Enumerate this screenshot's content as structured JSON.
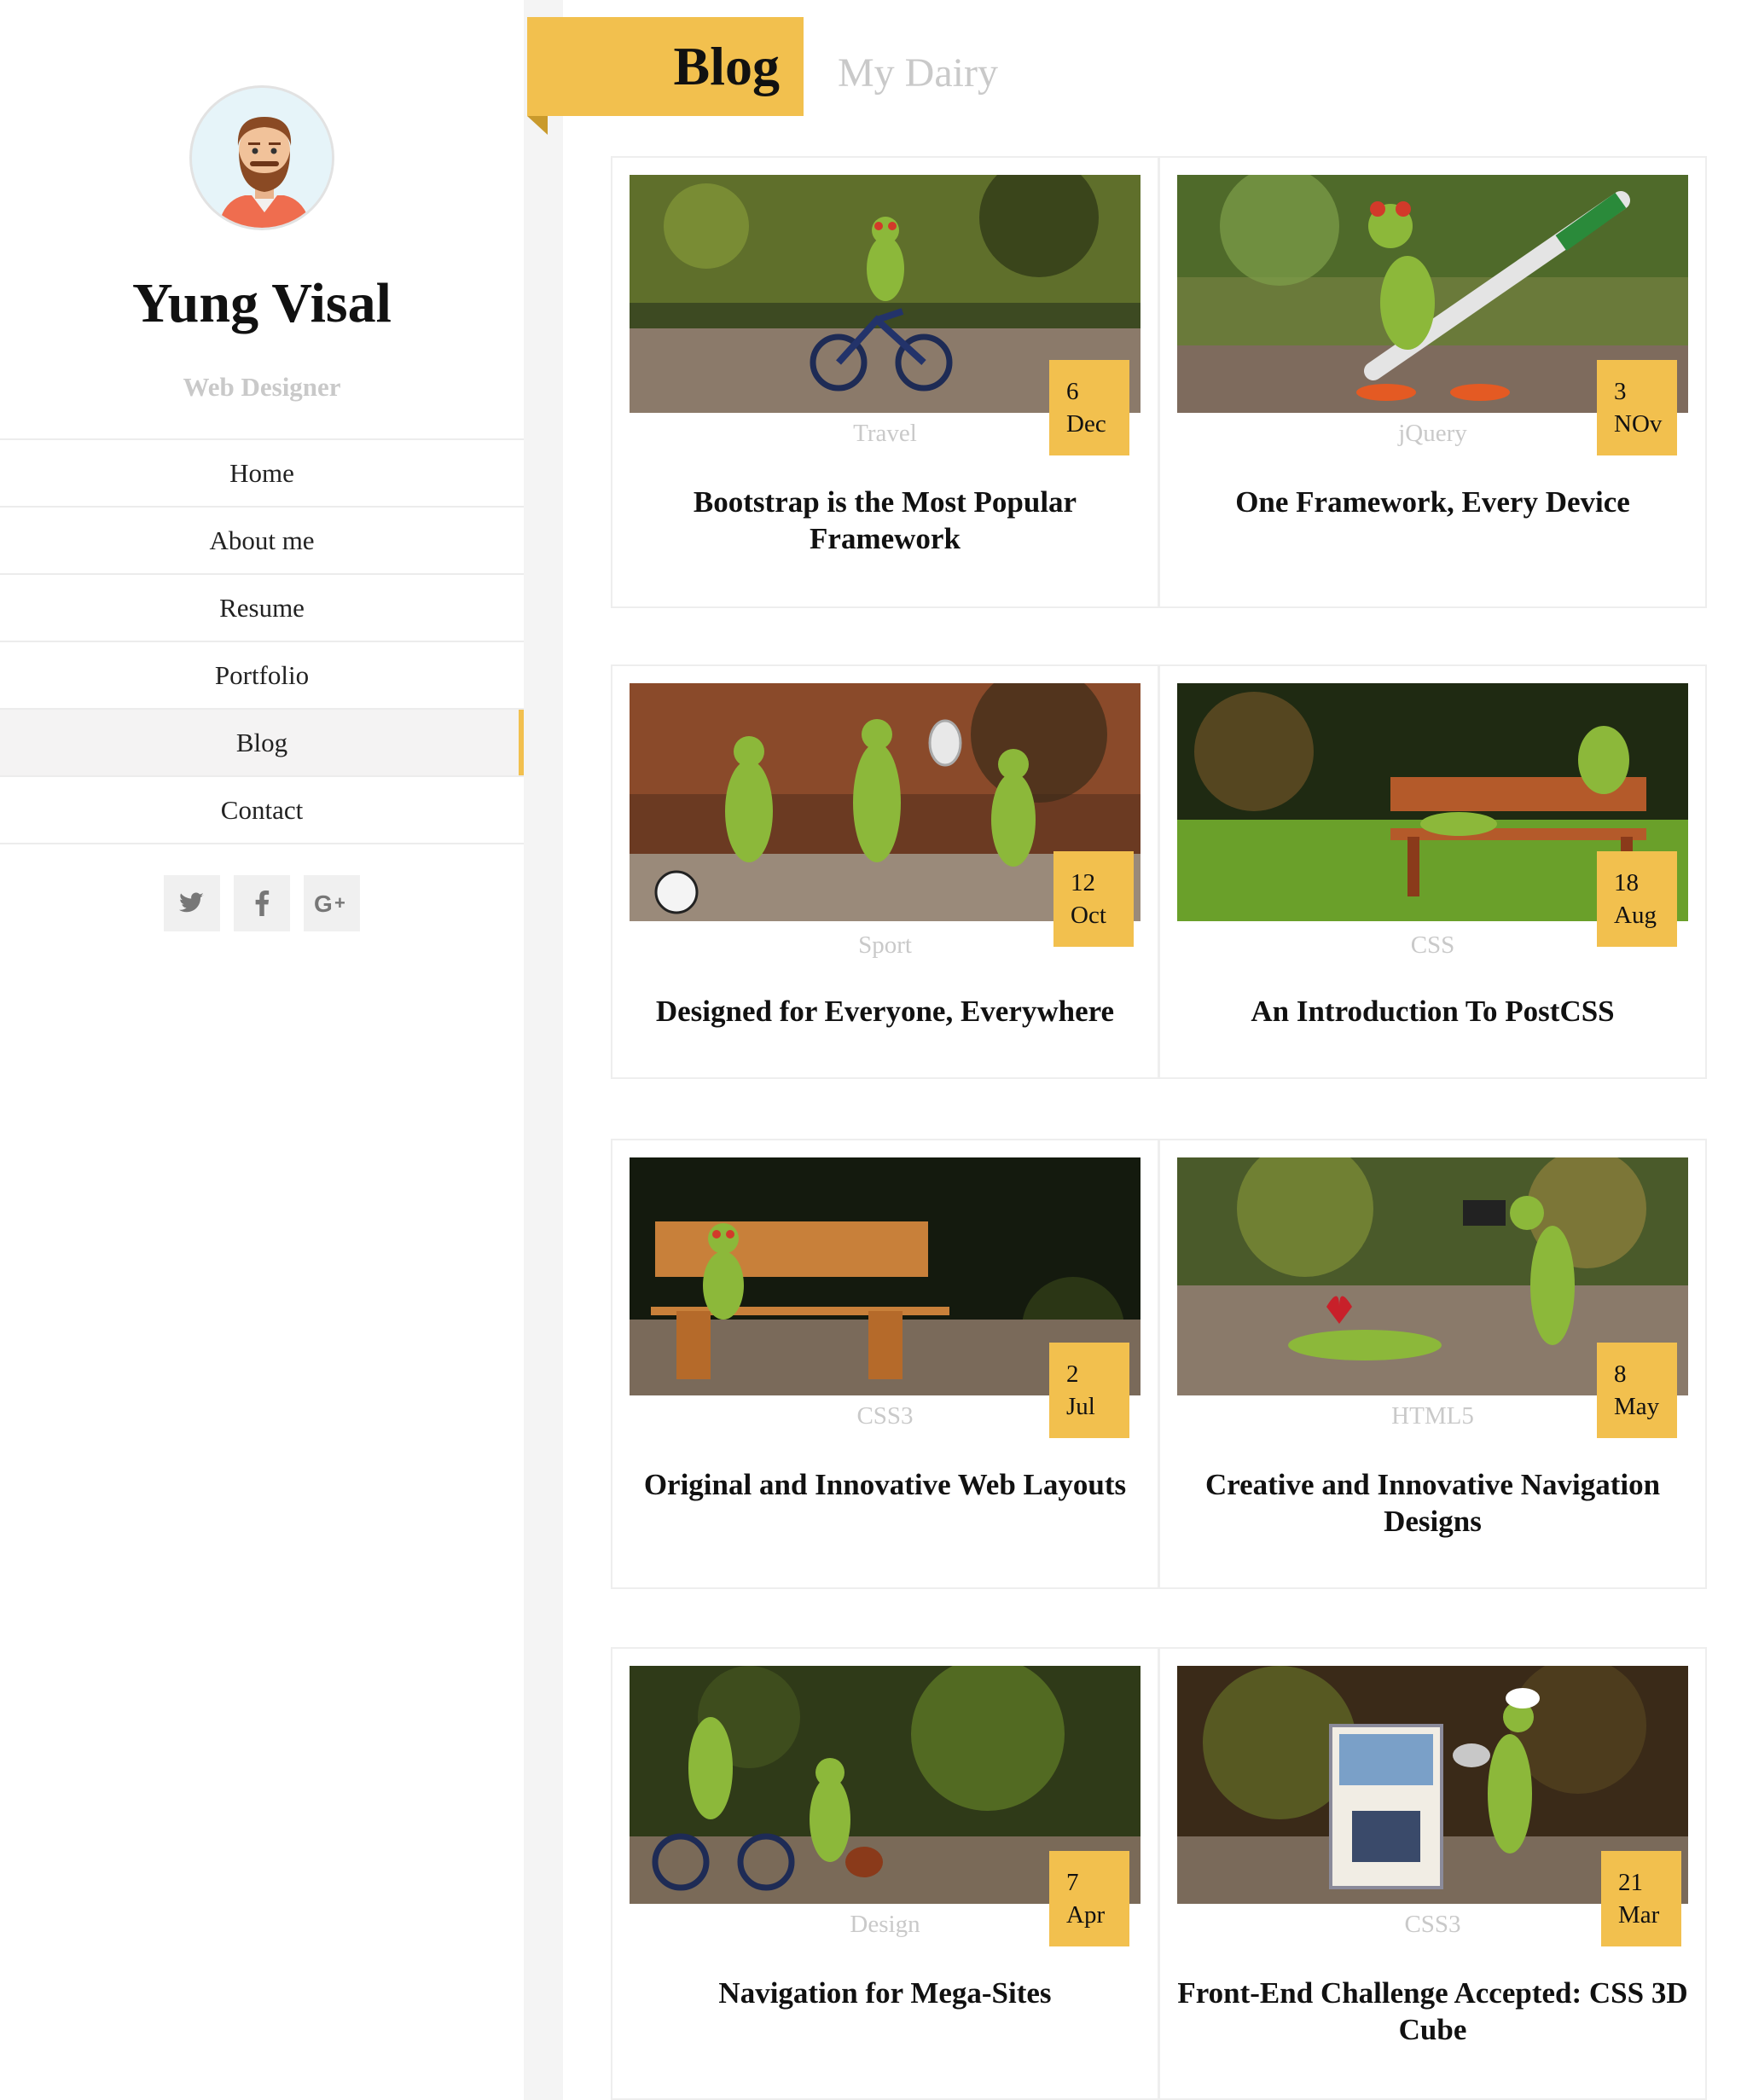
{
  "profile": {
    "name": "Yung Visal",
    "role": "Web Designer"
  },
  "nav": {
    "home": "Home",
    "about": "About me",
    "resume": "Resume",
    "portfolio": "Portfolio",
    "blog": "Blog",
    "contact": "Contact"
  },
  "social": {
    "twitter": "twitter-icon",
    "facebook": "facebook-icon",
    "googleplus": "googleplus-icon"
  },
  "header": {
    "tab": "Blog",
    "subtitle": "My Dairy"
  },
  "colors": {
    "accent": "#f2c04e",
    "muted_text": "#c9c9c9",
    "sidebar_active_bg": "#f4f3f3"
  },
  "posts": [
    {
      "day": "6",
      "month": "Dec",
      "category": "Travel",
      "title": "Bootstrap is the Most Popular Framework"
    },
    {
      "day": "3",
      "month": "NOv",
      "category": "jQuery",
      "title": "One Framework, Every Device"
    },
    {
      "day": "12",
      "month": "Oct",
      "category": "Sport",
      "title": "Designed for Everyone, Everywhere"
    },
    {
      "day": "18",
      "month": "Aug",
      "category": "CSS",
      "title": "An Introduction To PostCSS"
    },
    {
      "day": "2",
      "month": "Jul",
      "category": "CSS3",
      "title": "Original and Innovative Web Layouts"
    },
    {
      "day": "8",
      "month": "May",
      "category": "HTML5",
      "title": "Creative and Innovative Navigation Designs"
    },
    {
      "day": "7",
      "month": "Apr",
      "category": "Design",
      "title": "Navigation for Mega-Sites"
    },
    {
      "day": "21",
      "month": "Mar",
      "category": "CSS3",
      "title": "Front-End Challenge Accepted: CSS 3D Cube"
    }
  ]
}
